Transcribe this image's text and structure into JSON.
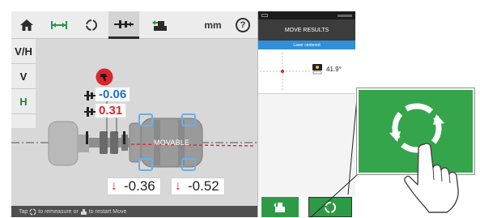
{
  "toolbar": {
    "unit": "mm",
    "help": "?"
  },
  "side_tabs": [
    "V/H",
    "V",
    "H"
  ],
  "measurements": {
    "coupling_vertical": "-0.06",
    "coupling_horizontal": "0.31",
    "foot_front": "-0.36",
    "foot_back": "-0.52",
    "arrow_glyph": "↓"
  },
  "machine": {
    "movable_label": "MOVABLE"
  },
  "status_bar": {
    "text_before": "Tap",
    "text_middle": "to remeasure or",
    "text_after": "to restart Move"
  },
  "results_panel": {
    "title": "MOVE RESULTS",
    "laser_status": "Laser centered",
    "angle": "41.9°"
  },
  "colors": {
    "accent_green": "#2f9a46",
    "value_blue": "#1f6fc4",
    "value_red": "#e0242a",
    "thumbs_badge": "#d8262c"
  },
  "icons": [
    "home-icon",
    "dimensions-icon",
    "measure-icon",
    "coupling-icon",
    "move-icon",
    "help-icon",
    "thumbs-down-icon",
    "remeasure-icon",
    "restart-move-icon",
    "hand-pointer-icon"
  ]
}
